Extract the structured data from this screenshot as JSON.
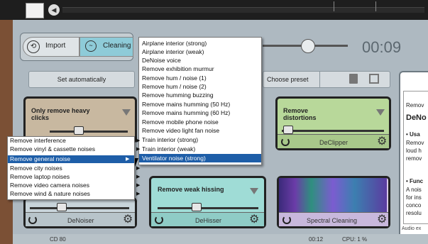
{
  "transport": {
    "time": "00:09"
  },
  "toolbar": {
    "import_label": "Import",
    "cleaning_label": "Cleaning"
  },
  "controls": {
    "set_automatically": "Set automatically",
    "choose_preset": "Choose preset"
  },
  "cards": {
    "heavy_clicks": {
      "title_line1": "Only remove heavy",
      "title_line2": "clicks"
    },
    "distortions": {
      "title_line1": "Remove",
      "title_line2": "distortions",
      "name": "DeClipper"
    },
    "denoiser": {
      "name": "DeNoiser"
    },
    "hissing": {
      "title": "Remove weak hissing",
      "name": "DeHisser"
    },
    "spectral": {
      "name": "Spectral Cleaning"
    }
  },
  "help": {
    "line1": "Remov",
    "line2": "DeNo",
    "line3": "• Usa",
    "line4": "Remov",
    "line5": "loud h",
    "line6": "remov",
    "line7": "• Func",
    "line8": "A nois",
    "line9": "for ins",
    "line10": "conco",
    "line11": "resolu",
    "footer": "Audio ex"
  },
  "status": {
    "left": "CD 80",
    "mid": "00:12",
    "cpu": "CPU: 1 %"
  },
  "menu": {
    "items": [
      "Airplane interior (strong)",
      "Airplane interior (weak)",
      "DeNoise voice",
      "Remove exhibition murmur",
      "Remove hum / noise (1)",
      "Remove hum / noise (2)",
      "Remove humming buzzing",
      "Remove mains humming (50 Hz)",
      "Remove mains humming (60 Hz)",
      "Remove mobile phone noise",
      "Remove video light fan noise",
      "Train interior (strong)",
      "Train interior (weak)",
      "Ventilator noise (strong)"
    ]
  },
  "submenu": {
    "items": [
      "Remove interference",
      "Remove vinyl & cassette noises",
      "Remove general noise",
      "Remove city noises",
      "Remove laptop noises",
      "Remove video camera noises",
      "Remove wind & nature noises"
    ],
    "arrow": "▶"
  }
}
